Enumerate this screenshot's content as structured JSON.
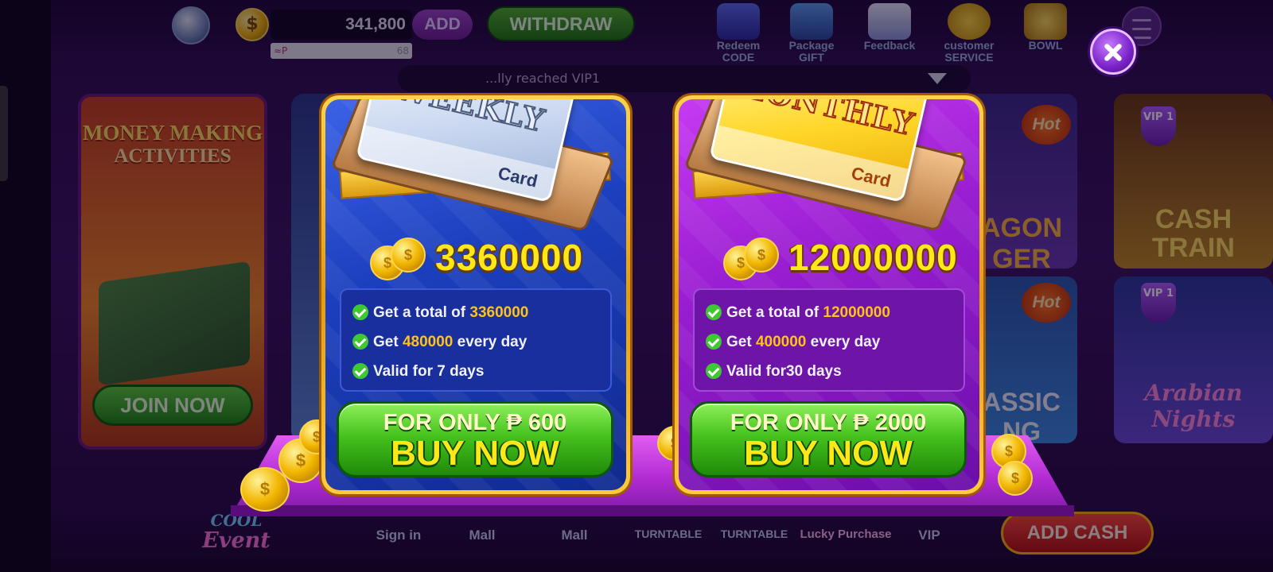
{
  "topbar": {
    "balance": "341,800",
    "add_label": "ADD",
    "withdraw_label": "WITHDRAW",
    "sub_left": "≈P",
    "sub_right": "68",
    "icons": [
      {
        "name": "redeem-code-icon",
        "label": "Redeem CODE"
      },
      {
        "name": "package-gift-icon",
        "label": "Package GIFT"
      },
      {
        "name": "feedback-icon",
        "label": "Feedback"
      },
      {
        "name": "customer-service-icon",
        "label": "customer SERVICE"
      },
      {
        "name": "treasure-bowl-icon",
        "label": "BOWL"
      }
    ]
  },
  "notice": {
    "text": "...lly reached VIP1"
  },
  "background": {
    "promo_title_1": "MONEY MAKING",
    "promo_title_2": "ACTIVITIES",
    "promo_join": "JOIN NOW",
    "tiles": {
      "hot": "Hot",
      "vip": "VIP 1",
      "dragon": "AGON GER",
      "cash_train": "CASH TRAIN",
      "classic": "ASSIC NG",
      "arabian": "Arabian Nights"
    }
  },
  "bottom_nav": {
    "cool_event_1": "COOL",
    "cool_event_2": "Event",
    "items": [
      "Sign in",
      "Mall",
      "Mall",
      "TURNTABLE",
      "TURNTABLE",
      "Lucky Purchase",
      "VIP"
    ],
    "add_cash": "ADD CASH"
  },
  "offers": [
    {
      "card_title": "WEEKLY",
      "card_sub": "Card",
      "amount": "3360000",
      "benefits": [
        {
          "prefix": "Get a total of ",
          "value": "3360000",
          "suffix": ""
        },
        {
          "prefix": "Get ",
          "value": "480000",
          "suffix": " every day"
        },
        {
          "prefix": "Valid for 7 days",
          "value": "",
          "suffix": ""
        }
      ],
      "price": "FOR ONLY ₱ 600",
      "cta": "BUY NOW",
      "theme": "#1c3fbe"
    },
    {
      "card_title": "MONTHLY",
      "card_sub": "Card",
      "amount": "12000000",
      "benefits": [
        {
          "prefix": "Get a total of ",
          "value": "12000000",
          "suffix": ""
        },
        {
          "prefix": "Get ",
          "value": "400000",
          "suffix": " every day"
        },
        {
          "prefix": "Valid for30 days",
          "value": "",
          "suffix": ""
        }
      ],
      "price": "FOR ONLY ₱ 2000",
      "cta": "BUY NOW",
      "theme": "#9a1ed2"
    }
  ],
  "colors": {
    "accent_gold": "#ffe81a",
    "highlight": "#ffc21a",
    "buy_green": "#46c21e"
  }
}
